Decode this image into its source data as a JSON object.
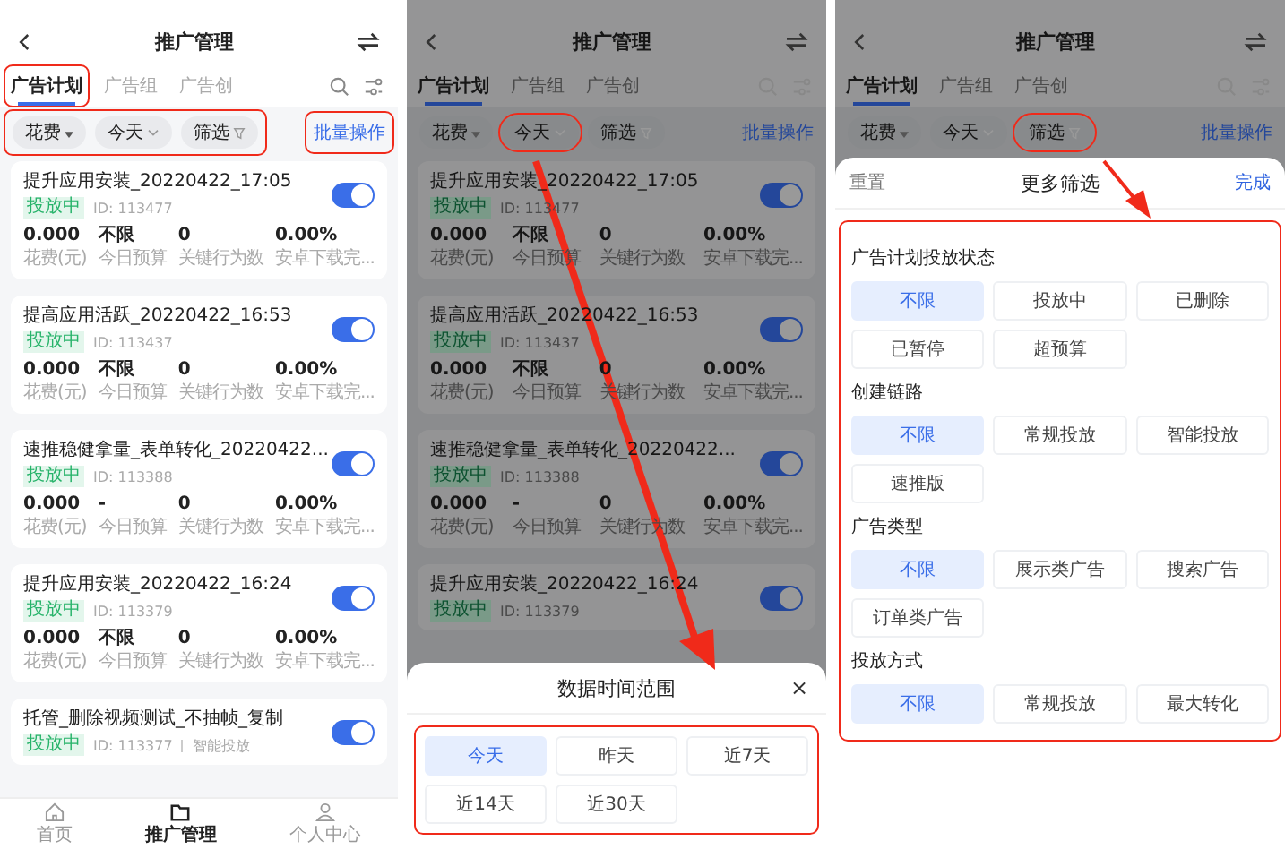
{
  "screens": [
    {
      "title": "推广管理",
      "tabs": [
        {
          "label": "广告计划",
          "selected": true,
          "annotated": true
        },
        {
          "label": "广告组",
          "selected": false,
          "annotated": false
        },
        {
          "label": "广告创",
          "selected": false,
          "annotated": false
        }
      ],
      "chips_annotated": true,
      "chips": [
        {
          "label": "花费",
          "kind": "sort",
          "annotated": false
        },
        {
          "label": "今天",
          "kind": "dropdown",
          "annotated": false
        },
        {
          "label": "筛选",
          "kind": "filter",
          "annotated": false
        }
      ],
      "batch": {
        "label": "批量操作",
        "annotated": true
      },
      "campaigns": [
        {
          "name": "提升应用安装_20220422_17:05",
          "status": "投放中",
          "id": "ID: 113477",
          "on": true,
          "metrics": [
            {
              "value": "0.000",
              "label": "花费(元)"
            },
            {
              "value": "不限",
              "label": "今日预算"
            },
            {
              "value": "0",
              "label": "关键行为数"
            },
            {
              "value": "0.00%",
              "label": "安卓下载完..."
            }
          ]
        },
        {
          "name": "提高应用活跃_20220422_16:53",
          "status": "投放中",
          "id": "ID: 113437",
          "on": true,
          "metrics": [
            {
              "value": "0.000",
              "label": "花费(元)"
            },
            {
              "value": "不限",
              "label": "今日预算"
            },
            {
              "value": "0",
              "label": "关键行为数"
            },
            {
              "value": "0.00%",
              "label": "安卓下载完..."
            }
          ]
        },
        {
          "name": "速推稳健拿量_表单转化_20220422...",
          "status": "投放中",
          "id": "ID: 113388",
          "on": true,
          "metrics": [
            {
              "value": "0.000",
              "label": "花费(元)"
            },
            {
              "value": "-",
              "label": "今日预算"
            },
            {
              "value": "0",
              "label": "关键行为数"
            },
            {
              "value": "0.00%",
              "label": "安卓下载完..."
            }
          ]
        },
        {
          "name": "提升应用安装_20220422_16:24",
          "status": "投放中",
          "id": "ID: 113379",
          "on": true,
          "metrics": [
            {
              "value": "0.000",
              "label": "花费(元)"
            },
            {
              "value": "不限",
              "label": "今日预算"
            },
            {
              "value": "0",
              "label": "关键行为数"
            },
            {
              "value": "0.00%",
              "label": "安卓下载完..."
            }
          ]
        },
        {
          "name": "托管_删除视频测试_不抽帧_复制",
          "status": "投放中",
          "id": "ID: 113377",
          "note": "智能投放",
          "on": true
        }
      ],
      "nav": [
        {
          "label": "首页",
          "kind": "home",
          "selected": false
        },
        {
          "label": "推广管理",
          "kind": "folder",
          "selected": true
        },
        {
          "label": "个人中心",
          "kind": "person",
          "selected": false
        }
      ]
    },
    {
      "title": "推广管理",
      "tabs": [
        {
          "label": "广告计划",
          "selected": true,
          "annotated": false
        },
        {
          "label": "广告组",
          "selected": false,
          "annotated": false
        },
        {
          "label": "广告创",
          "selected": false,
          "annotated": false
        }
      ],
      "chips_annotated": false,
      "chips": [
        {
          "label": "花费",
          "kind": "sort",
          "annotated": false
        },
        {
          "label": "今天",
          "kind": "dropdown",
          "annotated": true
        },
        {
          "label": "筛选",
          "kind": "filter",
          "annotated": false
        }
      ],
      "batch": {
        "label": "批量操作",
        "annotated": false
      },
      "campaigns": [
        {
          "name": "提升应用安装_20220422_17:05",
          "status": "投放中",
          "id": "ID: 113477",
          "on": true,
          "metrics": [
            {
              "value": "0.000",
              "label": "花费(元)"
            },
            {
              "value": "不限",
              "label": "今日预算"
            },
            {
              "value": "0",
              "label": "关键行为数"
            },
            {
              "value": "0.00%",
              "label": "安卓下载完..."
            }
          ]
        },
        {
          "name": "提高应用活跃_20220422_16:53",
          "status": "投放中",
          "id": "ID: 113437",
          "on": true,
          "metrics": [
            {
              "value": "0.000",
              "label": "花费(元)"
            },
            {
              "value": "不限",
              "label": "今日预算"
            },
            {
              "value": "0",
              "label": "关键行为数"
            },
            {
              "value": "0.00%",
              "label": "安卓下载完..."
            }
          ]
        },
        {
          "name": "速推稳健拿量_表单转化_20220422...",
          "status": "投放中",
          "id": "ID: 113388",
          "on": true,
          "metrics": [
            {
              "value": "0.000",
              "label": "花费(元)"
            },
            {
              "value": "-",
              "label": "今日预算"
            },
            {
              "value": "0",
              "label": "关键行为数"
            },
            {
              "value": "0.00%",
              "label": "安卓下载完..."
            }
          ]
        },
        {
          "name": "提升应用安装_20220422_16:24",
          "status": "投放中",
          "id": "ID: 113379",
          "on": true
        }
      ],
      "sheet": {
        "kind": "date",
        "title": "数据时间范围",
        "close": "×",
        "annotated": true,
        "options": [
          {
            "label": "今天",
            "selected": true
          },
          {
            "label": "昨天",
            "selected": false
          },
          {
            "label": "近7天",
            "selected": false
          },
          {
            "label": "近14天",
            "selected": false
          },
          {
            "label": "近30天",
            "selected": false
          }
        ]
      }
    },
    {
      "title": "推广管理",
      "tabs": [
        {
          "label": "广告计划",
          "selected": true,
          "annotated": false
        },
        {
          "label": "广告组",
          "selected": false,
          "annotated": false
        },
        {
          "label": "广告创",
          "selected": false,
          "annotated": false
        }
      ],
      "chips_annotated": false,
      "chips": [
        {
          "label": "花费",
          "kind": "sort",
          "annotated": false
        },
        {
          "label": "今天",
          "kind": "dropdown",
          "annotated": false
        },
        {
          "label": "筛选",
          "kind": "filter",
          "annotated": true
        }
      ],
      "batch": {
        "label": "批量操作",
        "annotated": false
      },
      "sheet": {
        "kind": "filters",
        "reset": "重置",
        "title": "更多筛选",
        "done": "完成",
        "annotated": true,
        "groups": [
          {
            "title": "广告计划投放状态",
            "options": [
              {
                "label": "不限",
                "selected": true
              },
              {
                "label": "投放中",
                "selected": false
              },
              {
                "label": "已删除",
                "selected": false
              },
              {
                "label": "已暂停",
                "selected": false
              },
              {
                "label": "超预算",
                "selected": false
              }
            ]
          },
          {
            "title": "创建链路",
            "options": [
              {
                "label": "不限",
                "selected": true
              },
              {
                "label": "常规投放",
                "selected": false
              },
              {
                "label": "智能投放",
                "selected": false
              },
              {
                "label": "速推版",
                "selected": false
              }
            ]
          },
          {
            "title": "广告类型",
            "options": [
              {
                "label": "不限",
                "selected": true
              },
              {
                "label": "展示类广告",
                "selected": false
              },
              {
                "label": "搜索广告",
                "selected": false
              },
              {
                "label": "订单类广告",
                "selected": false
              }
            ]
          },
          {
            "title": "投放方式",
            "options": [
              {
                "label": "不限",
                "selected": true
              },
              {
                "label": "常规投放",
                "selected": false
              },
              {
                "label": "最大转化",
                "selected": false
              }
            ]
          }
        ]
      }
    }
  ]
}
